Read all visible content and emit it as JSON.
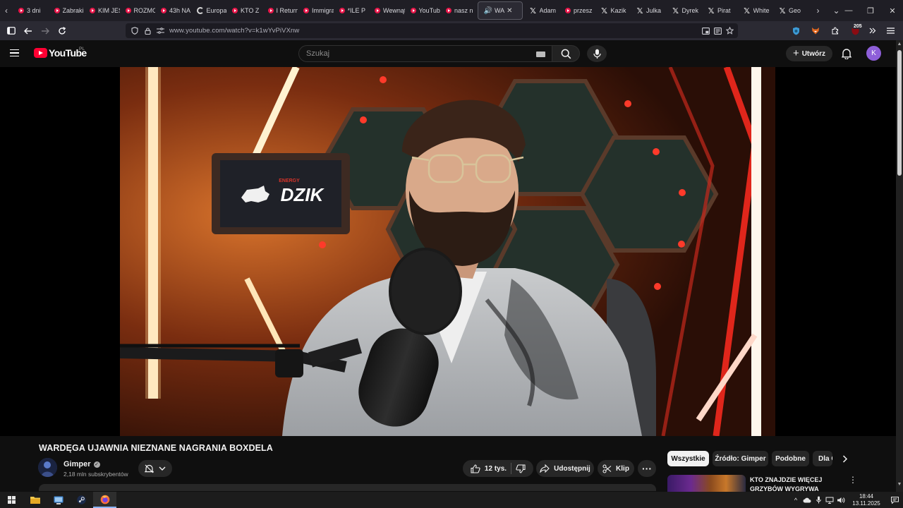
{
  "browser": {
    "tabs": [
      {
        "title": "3 dni",
        "icon": "youtube-icon"
      },
      {
        "title": "Zabraki",
        "icon": "youtube-icon"
      },
      {
        "title": "KIM JEST",
        "icon": "youtube-icon"
      },
      {
        "title": "ROZMOWA",
        "icon": "youtube-icon"
      },
      {
        "title": "43h NA",
        "icon": "youtube-icon"
      },
      {
        "title": "Europa",
        "icon": "ring-icon"
      },
      {
        "title": "KTO Z",
        "icon": "youtube-icon"
      },
      {
        "title": "I Return",
        "icon": "youtube-icon"
      },
      {
        "title": "Immigrant",
        "icon": "youtube-icon"
      },
      {
        "title": "*ILE P",
        "icon": "youtube-icon"
      },
      {
        "title": "Wewnątrz",
        "icon": "youtube-icon"
      },
      {
        "title": "YouTube",
        "icon": "youtube-icon"
      },
      {
        "title": "nasz n",
        "icon": "youtube-icon"
      },
      {
        "title": "WA",
        "icon": "youtube-icon",
        "active": true
      },
      {
        "title": "Adam",
        "icon": "x-icon"
      },
      {
        "title": "przesz",
        "icon": "youtube-icon"
      },
      {
        "title": "Kazik",
        "icon": "x-icon"
      },
      {
        "title": "Julka",
        "icon": "x-icon"
      },
      {
        "title": "Dyrek",
        "icon": "x-icon"
      },
      {
        "title": "Pirat",
        "icon": "x-icon"
      },
      {
        "title": "White",
        "icon": "x-icon"
      },
      {
        "title": "Geo",
        "icon": "x-icon"
      }
    ],
    "url": "www.youtube.com/watch?v=k1wYvPiVXnw",
    "extension_badge": "205"
  },
  "youtube": {
    "logo_text": "YouTube",
    "country_code": "PL",
    "search_placeholder": "Szukaj",
    "create_label": "Utwórz",
    "account_initial": "K"
  },
  "video": {
    "title": "WARDĘGA UJAWNIA NIEZNANE NAGRANIA BOXDELA",
    "channel": "Gimper",
    "subscribers": "2,18 mln subskrybentów",
    "likes": "12 tys.",
    "share_label": "Udostępnij",
    "clip_label": "Klip",
    "sign_text": "DZIK",
    "sign_subtext": "ENERGY"
  },
  "sidebar": {
    "chips": [
      "Wszystkie",
      "Źródło: Gimper",
      "Podobne",
      "Dla Ciebie"
    ],
    "recommendation_title": "KTO ZNAJDZIE WIĘCEJ GRZYBÓW WYGRYWA *AFERA*"
  },
  "taskbar": {
    "time": "18:44",
    "date": "13.11.2025"
  },
  "colors": {
    "youtube_red": "#ff0033",
    "avatar_purple": "#8e5fd9",
    "browser_chrome": "#2b2a33"
  }
}
